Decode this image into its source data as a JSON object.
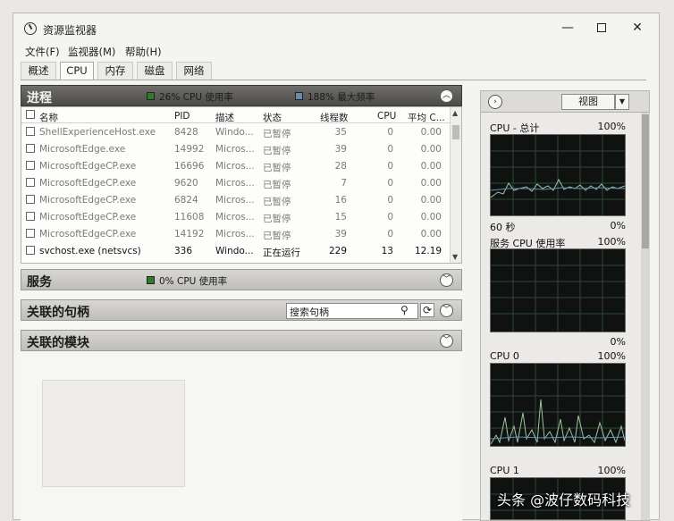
{
  "window": {
    "title": "资源监视器",
    "controls": {
      "minimize": "—",
      "close": "✕"
    }
  },
  "menu": [
    "文件(F)",
    "监视器(M)",
    "帮助(H)"
  ],
  "tabs": [
    "概述",
    "CPU",
    "内存",
    "磁盘",
    "网络"
  ],
  "active_tab": "CPU",
  "processes": {
    "title": "进程",
    "cpu_usage": "26% CPU 使用率",
    "max_freq": "188% 最大频率",
    "columns": [
      "名称",
      "PID",
      "描述",
      "状态",
      "线程数",
      "CPU",
      "平均 C..."
    ],
    "rows": [
      {
        "name": "ShellExperienceHost.exe",
        "pid": "8428",
        "desc": "Windo...",
        "status": "已暂停",
        "threads": "35",
        "cpu": "0",
        "avg": "0.00"
      },
      {
        "name": "MicrosoftEdge.exe",
        "pid": "14992",
        "desc": "Micros...",
        "status": "已暂停",
        "threads": "39",
        "cpu": "0",
        "avg": "0.00"
      },
      {
        "name": "MicrosoftEdgeCP.exe",
        "pid": "16696",
        "desc": "Micros...",
        "status": "已暂停",
        "threads": "28",
        "cpu": "0",
        "avg": "0.00"
      },
      {
        "name": "MicrosoftEdgeCP.exe",
        "pid": "9620",
        "desc": "Micros...",
        "status": "已暂停",
        "threads": "7",
        "cpu": "0",
        "avg": "0.00"
      },
      {
        "name": "MicrosoftEdgeCP.exe",
        "pid": "6824",
        "desc": "Micros...",
        "status": "已暂停",
        "threads": "16",
        "cpu": "0",
        "avg": "0.00"
      },
      {
        "name": "MicrosoftEdgeCP.exe",
        "pid": "11608",
        "desc": "Micros...",
        "status": "已暂停",
        "threads": "15",
        "cpu": "0",
        "avg": "0.00"
      },
      {
        "name": "MicrosoftEdgeCP.exe",
        "pid": "14192",
        "desc": "Micros...",
        "status": "已暂停",
        "threads": "39",
        "cpu": "0",
        "avg": "0.00"
      },
      {
        "name": "svchost.exe (netsvcs)",
        "pid": "336",
        "desc": "Windo...",
        "status": "正在运行",
        "threads": "229",
        "cpu": "13",
        "avg": "12.19"
      }
    ]
  },
  "services": {
    "title": "服务",
    "cpu_usage": "0% CPU 使用率"
  },
  "handles": {
    "title": "关联的句柄",
    "search_placeholder": "搜索句柄"
  },
  "modules": {
    "title": "关联的模块"
  },
  "right_panel": {
    "view_label": "视图",
    "graphs": [
      {
        "label": "CPU - 总计",
        "max": "100%",
        "time": "60 秒",
        "min": "0%"
      },
      {
        "label": "服务 CPU 使用率",
        "max": "100%",
        "min": "0%"
      },
      {
        "label": "CPU 0",
        "max": "100%",
        "min": "0%"
      },
      {
        "label": "CPU 1",
        "max": "100%"
      }
    ]
  },
  "watermark": "头条 @波仔数码科技",
  "colors": {
    "graph_bg": "#0f1210",
    "graph_line": "#9bc59d",
    "grid": "#2e4a33",
    "section_header": "#5a5956"
  }
}
